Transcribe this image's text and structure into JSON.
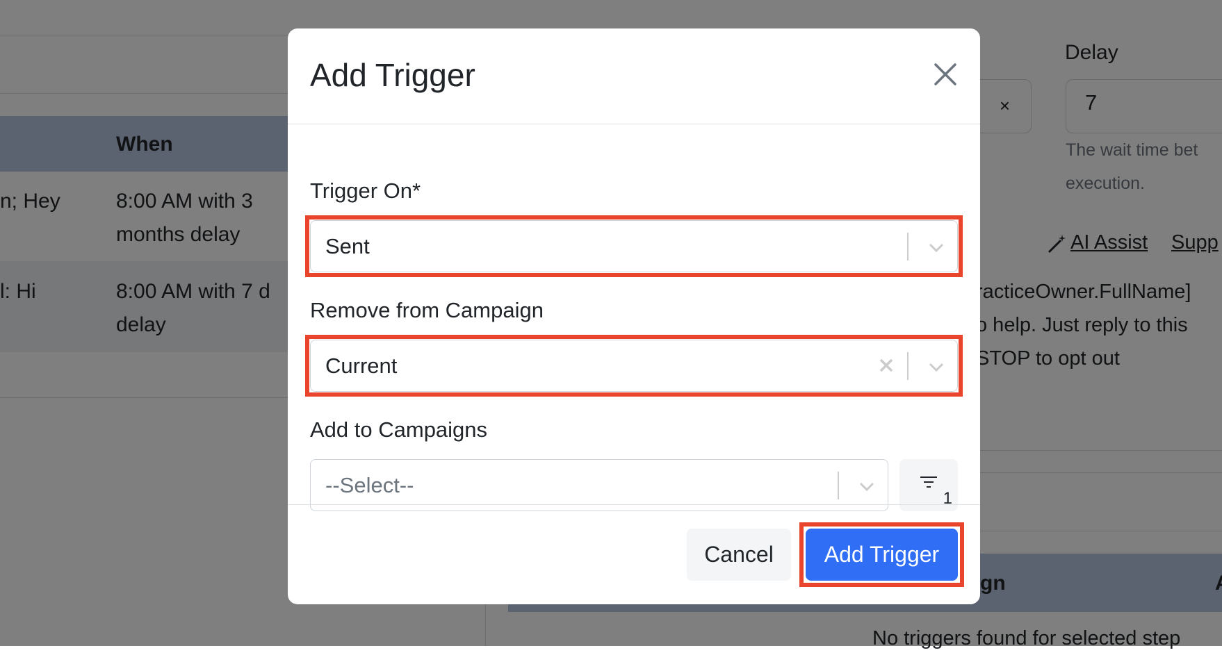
{
  "background": {
    "table_header_when": "When",
    "rows": [
      {
        "preview": "n; Hey",
        "when_line1": "8:00 AM with 3",
        "when_line2": "months delay"
      },
      {
        "preview": "l: Hi",
        "when_line1": "8:00 AM with 7 d",
        "when_line2": "delay"
      }
    ],
    "delay_label": "Delay",
    "delay_value": "7",
    "delay_help_line1": "The wait time bet",
    "delay_help_line2": "execution.",
    "ai_assist_label": "AI Assist",
    "support_link": "Supp",
    "message_line1": "racticeOwner.FullName]",
    "message_line2": "o help. Just reply to this",
    "message_line3": "STOP to opt out",
    "right_table_header_fragment": "gn",
    "right_table_header_fragment2": "A",
    "no_triggers_text": "No triggers found for selected step"
  },
  "modal": {
    "title": "Add Trigger",
    "trigger_on": {
      "label": "Trigger On*",
      "value": "Sent"
    },
    "remove_from_campaign": {
      "label": "Remove from Campaign",
      "value": "Current"
    },
    "add_to_campaigns": {
      "label": "Add to Campaigns",
      "placeholder": "--Select--",
      "filter_count": "1"
    },
    "cancel_label": "Cancel",
    "submit_label": "Add Trigger"
  },
  "colors": {
    "primary": "#2f6ef5",
    "highlight": "#e8452c",
    "table_header": "#b9c7e0"
  }
}
